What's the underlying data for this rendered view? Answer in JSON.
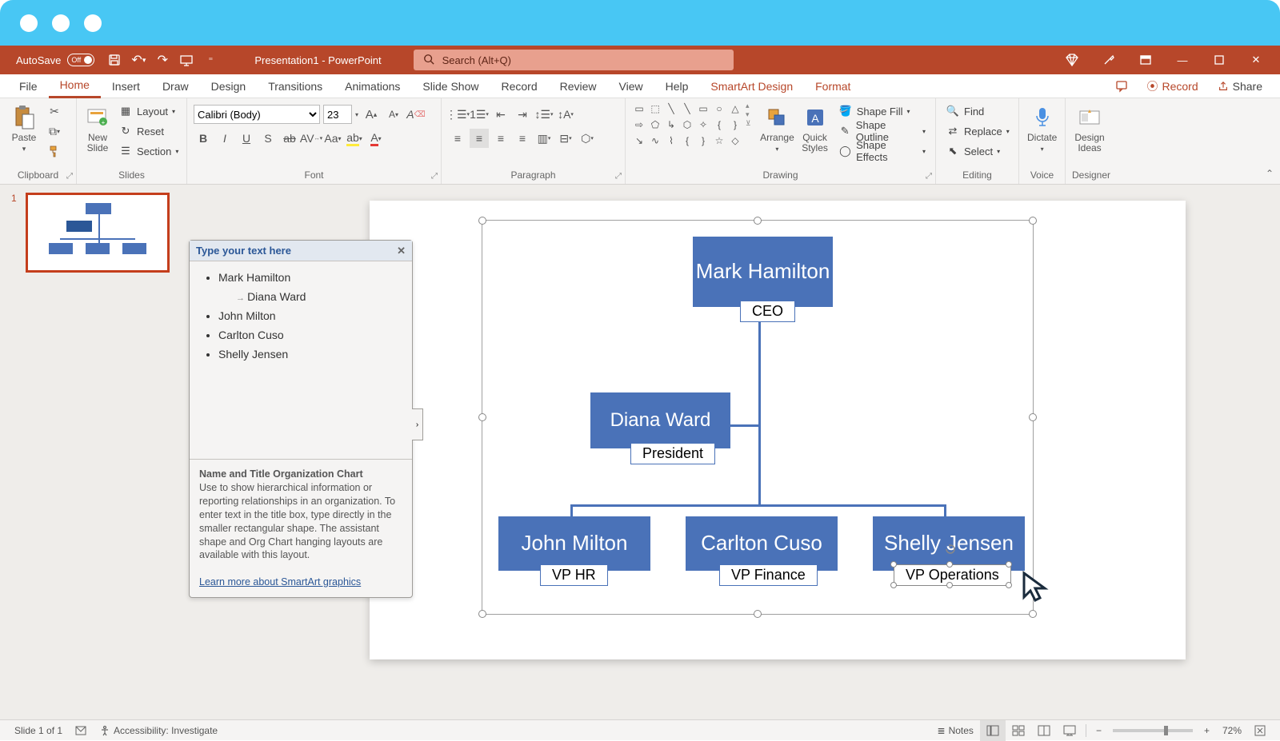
{
  "titlebar": {},
  "qat": {
    "autosave_label": "AutoSave",
    "autosave_state": "Off",
    "title": "Presentation1 - PowerPoint",
    "search_placeholder": "Search (Alt+Q)"
  },
  "tabs": {
    "file": "File",
    "home": "Home",
    "insert": "Insert",
    "draw": "Draw",
    "design": "Design",
    "transitions": "Transitions",
    "animations": "Animations",
    "slideshow": "Slide Show",
    "record": "Record",
    "review": "Review",
    "view": "View",
    "help": "Help",
    "smartart_design": "SmartArt Design",
    "format": "Format",
    "comments": "",
    "record_btn": "Record",
    "share": "Share"
  },
  "ribbon": {
    "clipboard": {
      "label": "Clipboard",
      "paste": "Paste"
    },
    "slides": {
      "label": "Slides",
      "new_slide": "New\nSlide",
      "layout": "Layout",
      "reset": "Reset",
      "section": "Section"
    },
    "font": {
      "label": "Font",
      "name": "Calibri (Body)",
      "size": "23"
    },
    "paragraph": {
      "label": "Paragraph"
    },
    "drawing": {
      "label": "Drawing",
      "arrange": "Arrange",
      "quick_styles": "Quick\nStyles",
      "shape_fill": "Shape Fill",
      "shape_outline": "Shape Outline",
      "shape_effects": "Shape Effects"
    },
    "editing": {
      "label": "Editing",
      "find": "Find",
      "replace": "Replace",
      "select": "Select"
    },
    "voice": {
      "label": "Voice",
      "dictate": "Dictate"
    },
    "designer": {
      "label": "Designer",
      "design_ideas": "Design\nIdeas"
    }
  },
  "thumb": {
    "num": "1"
  },
  "textpane": {
    "header": "Type your text here",
    "items": [
      "Mark Hamilton",
      "Diana Ward",
      "John Milton",
      "Carlton Cuso",
      "Shelly Jensen"
    ],
    "desc_title": "Name and Title Organization Chart",
    "desc_body": "Use to show hierarchical information or reporting relationships in an organization. To enter text in the title box, type directly in the smaller rectangular shape. The assistant shape and Org Chart hanging layouts are available with this layout.",
    "learn_more": "Learn more about SmartArt graphics"
  },
  "org": {
    "p1_name": "Mark Hamilton",
    "p1_title": "CEO",
    "p2_name": "Diana Ward",
    "p2_title": "President",
    "p3_name": "John Milton",
    "p3_title": "VP HR",
    "p4_name": "Carlton Cuso",
    "p4_title": "VP Finance",
    "p5_name": "Shelly Jensen",
    "p5_title": "VP Operations"
  },
  "status": {
    "slide_info": "Slide 1 of 1",
    "accessibility": "Accessibility: Investigate",
    "notes": "Notes",
    "zoom": "72%"
  }
}
